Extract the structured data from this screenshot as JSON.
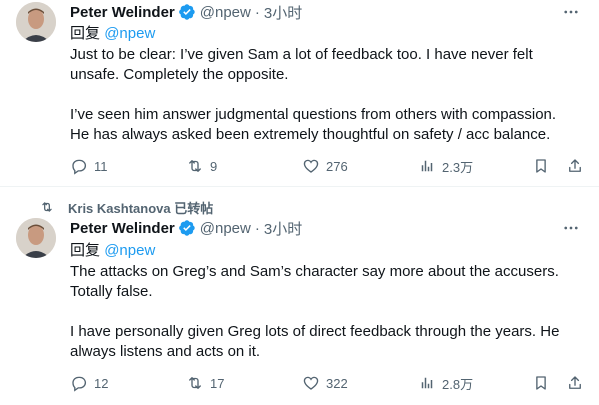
{
  "tweets": [
    {
      "author": "Peter Welinder",
      "handle": "@npew",
      "dot": "·",
      "time": "3小时",
      "reply_prefix": "回复",
      "reply_mention": "@npew",
      "lines": [
        "Just to be clear: I’ve given Sam a lot of feedback too. I have never felt",
        "unsafe. Completely the opposite.",
        "",
        "I’ve seen him answer judgmental questions from others with compassion.",
        "He has always asked been extremely thoughtful on safety / acc balance."
      ],
      "stats": {
        "replies": "11",
        "retweets": "9",
        "likes": "276",
        "views": "2.3万"
      }
    },
    {
      "retweet_context": "Kris Kashtanova 已转帖",
      "author": "Peter Welinder",
      "handle": "@npew",
      "dot": "·",
      "time": "3小时",
      "reply_prefix": "回复",
      "reply_mention": "@npew",
      "lines": [
        "The attacks on Greg’s and Sam’s character say more about the accusers.",
        "Totally false.",
        "",
        "I have personally given Greg lots of direct feedback through the years. He",
        "always listens and acts on it."
      ],
      "stats": {
        "replies": "12",
        "retweets": "17",
        "likes": "322",
        "views": "2.8万"
      }
    }
  ],
  "icons": {
    "verified": "verified-badge-icon",
    "more": "more-dots-icon",
    "reply": "reply-icon",
    "retweet": "retweet-icon",
    "like": "heart-icon",
    "views": "views-icon",
    "bookmark": "bookmark-icon",
    "share": "share-icon"
  },
  "colors": {
    "accent": "#1d9bf0",
    "text": "#0f1419",
    "muted": "#536471",
    "divider": "#eff3f4"
  }
}
